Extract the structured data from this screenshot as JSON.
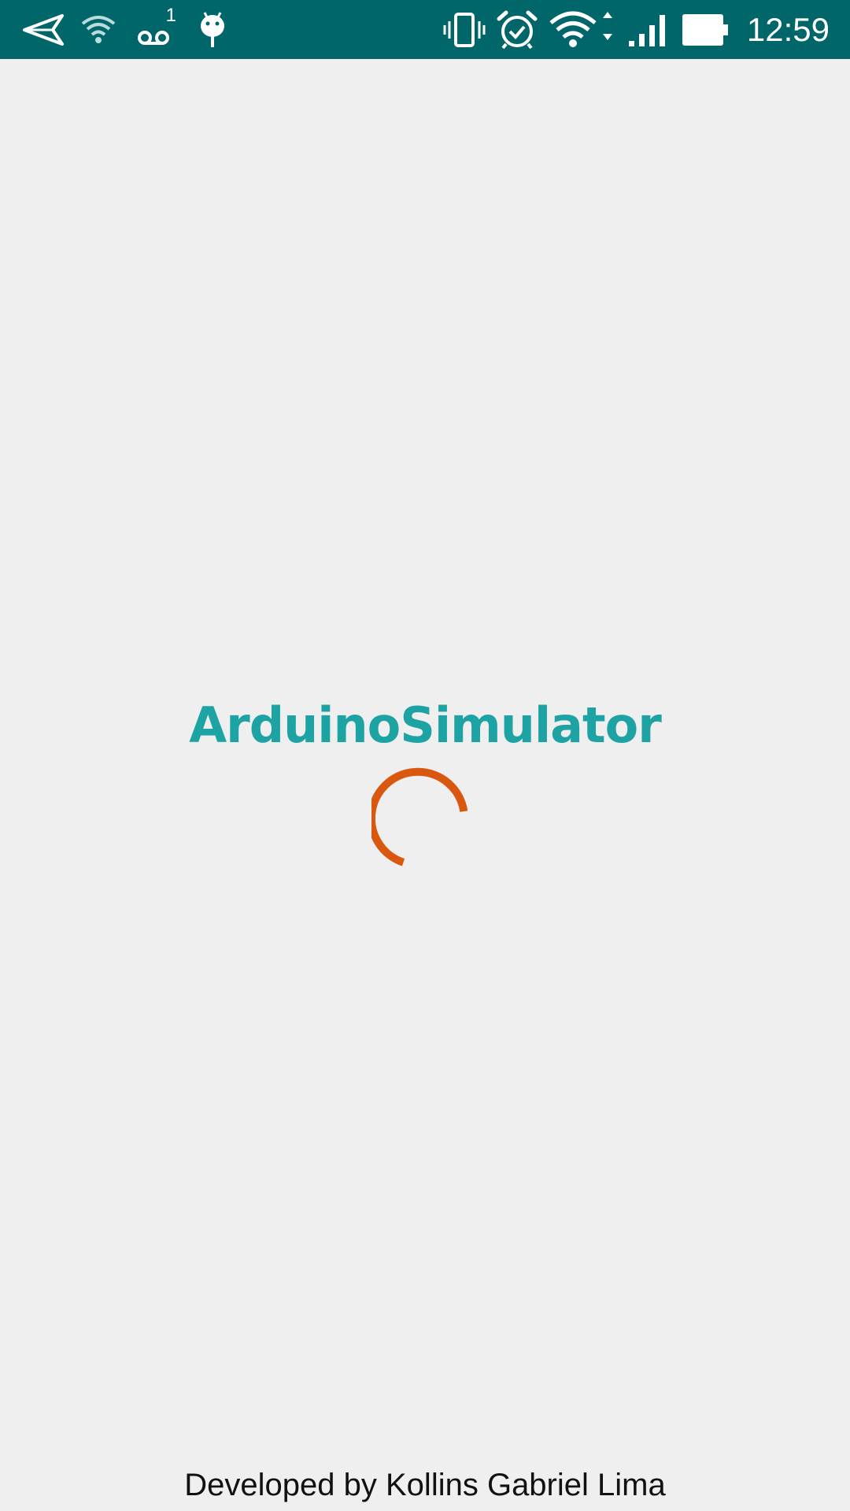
{
  "status_bar": {
    "time": "12:59",
    "voicemail_count": "1",
    "left_icons": [
      "send-icon",
      "wifi-weak-icon",
      "voicemail-icon",
      "android-debug-icon"
    ],
    "right_icons": [
      "vibrate-icon",
      "alarm-icon",
      "wifi-icon",
      "signal-icon",
      "battery-icon"
    ],
    "background_color": "#00666a"
  },
  "splash": {
    "app_title": "ArduinoSimulator",
    "title_color": "#1ea3a5",
    "spinner_color": "#d9570f",
    "credit": "Developed by Kollins Gabriel Lima"
  }
}
